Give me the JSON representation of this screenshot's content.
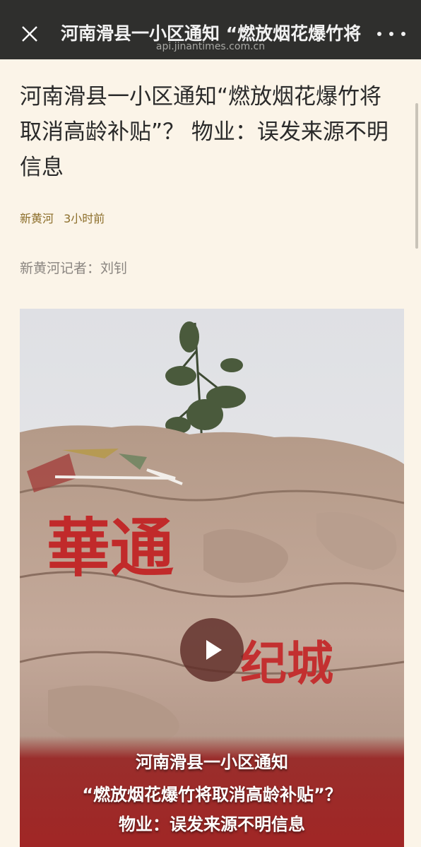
{
  "topbar": {
    "title": "河南滑县一小区通知 “燃放烟花爆竹将",
    "url": "api.jinantimes.com.cn",
    "close_icon": "close-icon",
    "more_icon": "more-dots-icon",
    "background": "#2f2f2d"
  },
  "article": {
    "headline": "河南滑县一小区通知“燃放烟花爆竹将取消高龄补贴”？ 物业：误发来源不明信息",
    "source": "新黄河",
    "time": "3小时前",
    "reporter": "新黄河记者：刘钊"
  },
  "video": {
    "rock_text_1": "華通",
    "rock_text_2": "纪城",
    "caption_lines": [
      "河南滑县一小区通知",
      "“燃放烟花爆竹将取消高龄补贴”？",
      "物业：误发来源不明信息"
    ],
    "play_icon": "play-icon"
  },
  "colors": {
    "page_bg": "#fbf4e8",
    "accent": "#8c6e2a",
    "caption_band": "#a01e1e"
  }
}
